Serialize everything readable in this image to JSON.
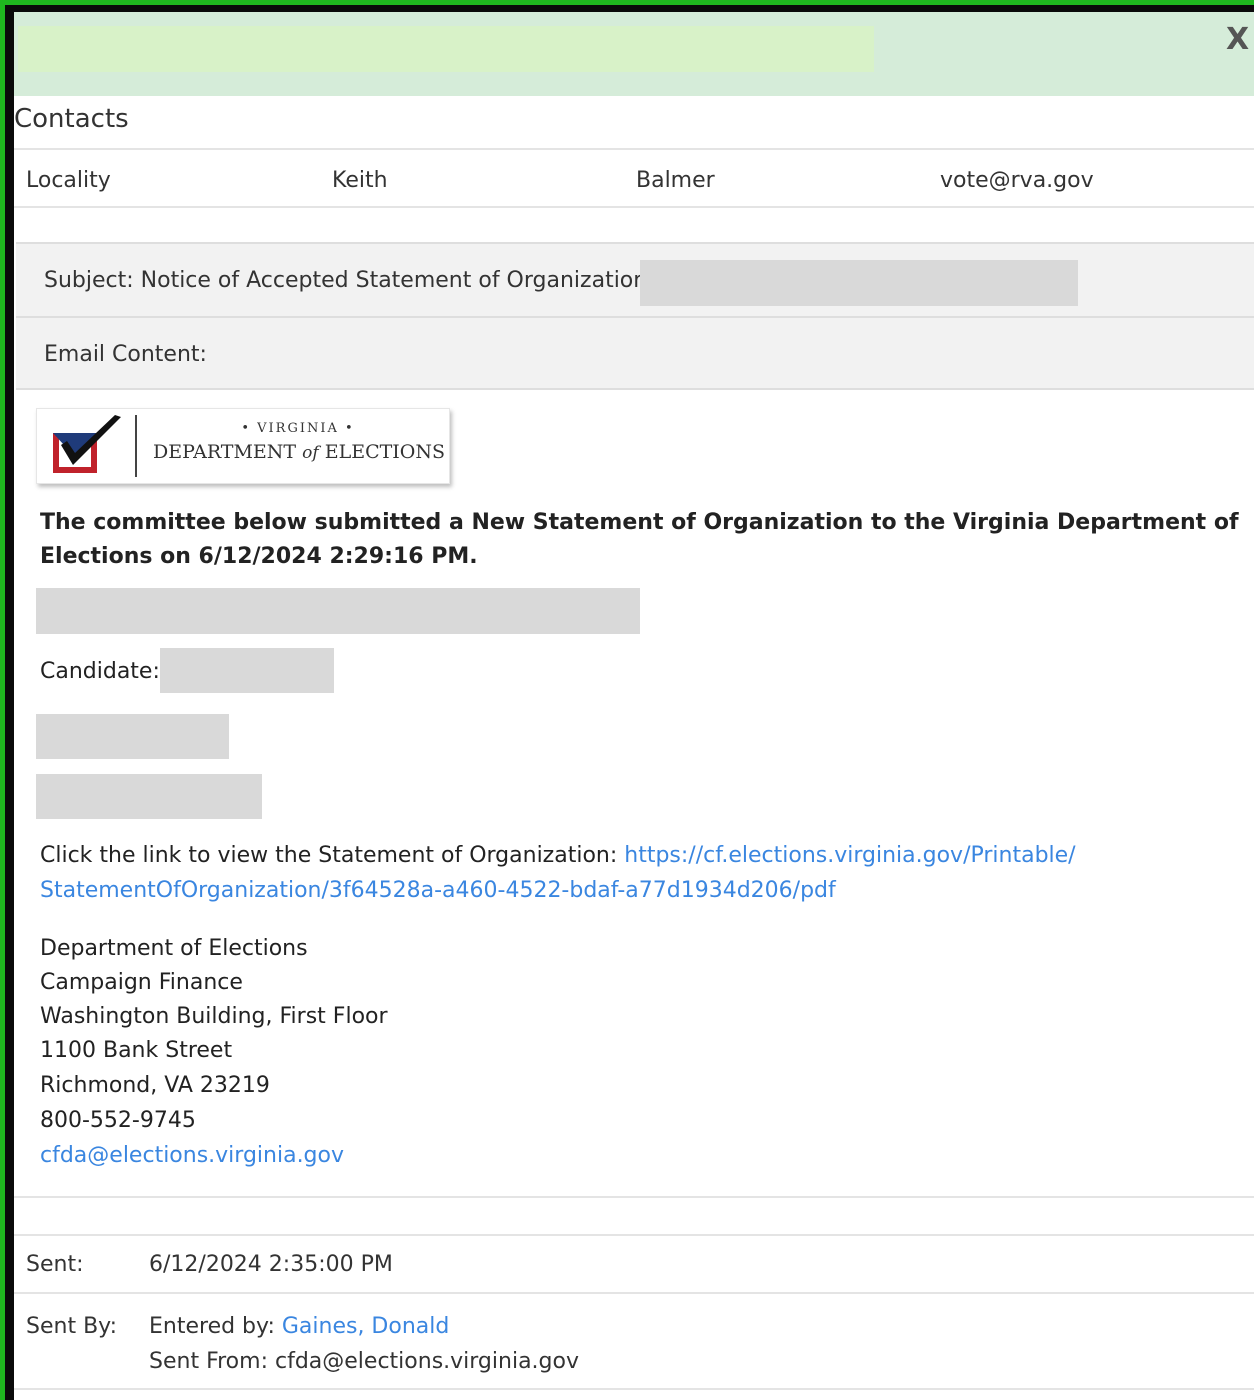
{
  "window": {
    "close_label": "X"
  },
  "contacts": {
    "heading": "Contacts",
    "row": {
      "type": "Locality",
      "first_name": "Keith",
      "last_name": "Balmer",
      "email": "vote@rva.gov"
    }
  },
  "subject": {
    "label": "Subject: Notice of Accepted Statement of Organization -"
  },
  "email_content": {
    "label": "Email Content:",
    "logo": {
      "state": "• VIRGINIA •",
      "dept_pre": "DEPARTMENT",
      "dept_of": "of",
      "dept_post": "ELECTIONS"
    },
    "intro_line1": "The committee below submitted a New Statement of Organization to the Virginia Department of",
    "intro_line2": "Elections on 6/12/2024 2:29:16 PM.",
    "candidate_label": "Candidate:",
    "link_intro": "Click the link to view the Statement of Organization:",
    "link_part1": "https://cf.elections.virginia.gov/Printable/",
    "link_part2": "StatementOfOrganization/3f64528a-a460-4522-bdaf-a77d1934d206/pdf",
    "address": [
      "Department of Elections",
      "Campaign Finance",
      "Washington Building, First Floor",
      "1100 Bank Street",
      "Richmond, VA 23219",
      "800-552-9745"
    ],
    "contact_email": "cfda@elections.virginia.gov"
  },
  "meta": {
    "sent_label": "Sent:",
    "sent_value": "6/12/2024 2:35:00 PM",
    "sent_by_label": "Sent By:",
    "entered_by_label": "Entered by:",
    "entered_by_name": "Gaines, Donald",
    "sent_from_label": "Sent From:",
    "sent_from_value": "cfda@elections.virginia.gov"
  },
  "colors": {
    "border_green": "#1fb71f",
    "titlebar": "#d5ecd9",
    "link": "#3a86e0",
    "redaction": "#d9d9d9"
  }
}
